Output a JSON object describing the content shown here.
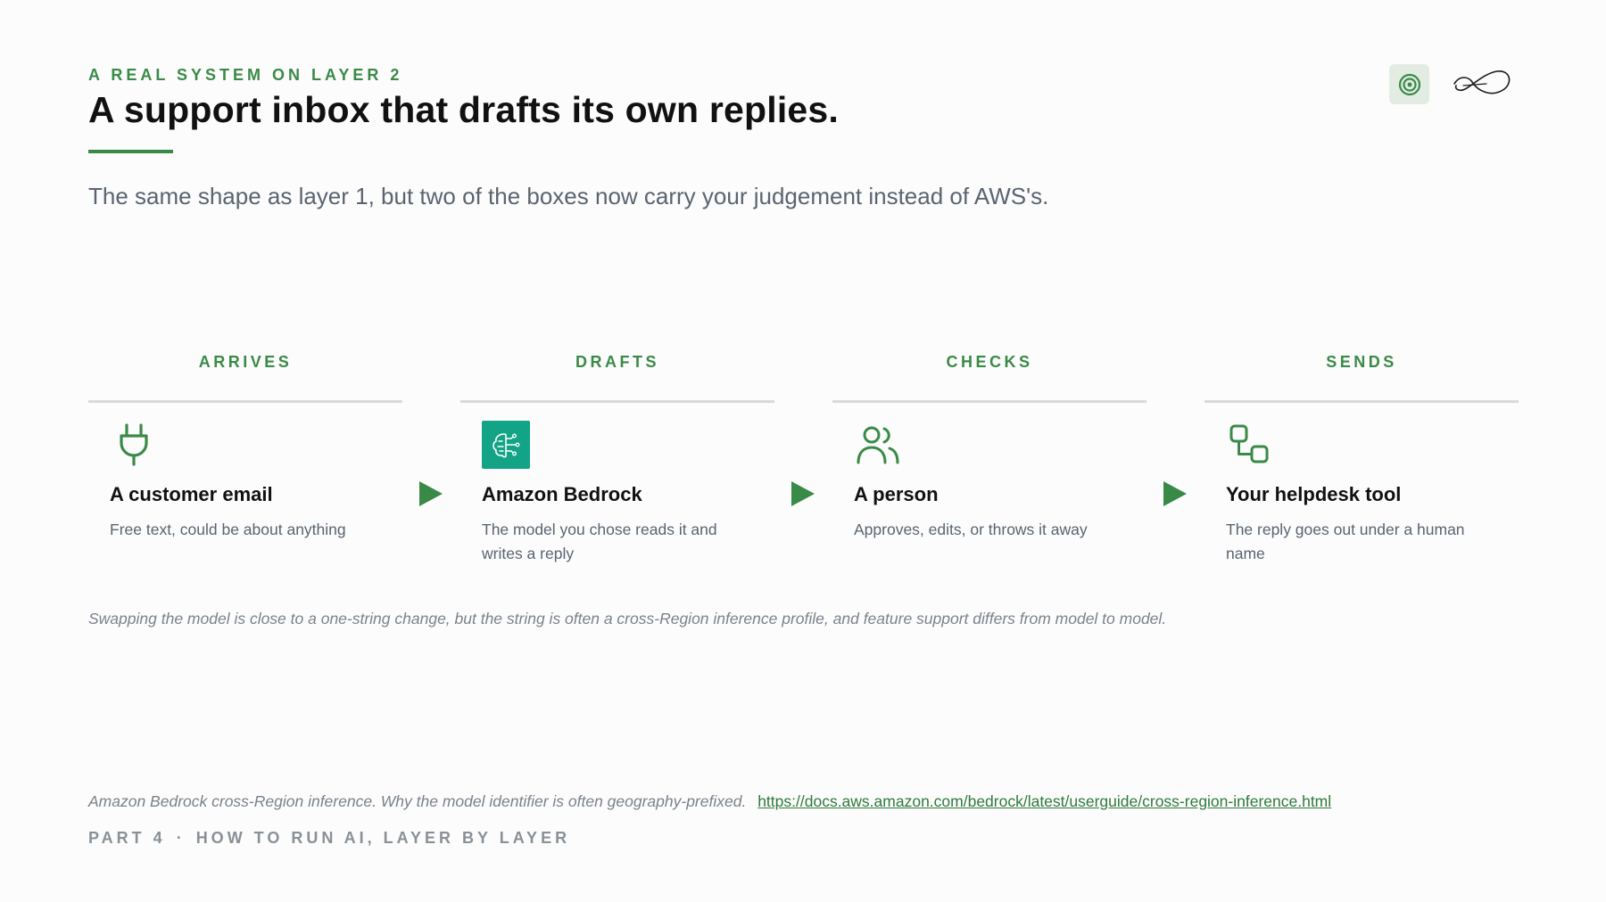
{
  "header": {
    "eyebrow": "A REAL SYSTEM ON LAYER 2",
    "title": "A support inbox that drafts its own replies.",
    "subtitle": "The same shape as layer 1, but two of the boxes now carry your judgement instead of AWS's."
  },
  "logos": {
    "target_icon": "target-icon",
    "signature_icon": "signature-icon"
  },
  "steps": [
    {
      "heading": "ARRIVES",
      "icon": "plug-icon",
      "title": "A customer email",
      "desc": "Free text, could be about anything"
    },
    {
      "heading": "DRAFTS",
      "icon": "bedrock-brain-icon",
      "title": "Amazon Bedrock",
      "desc": "The model you chose reads it and writes a reply"
    },
    {
      "heading": "CHECKS",
      "icon": "people-icon",
      "title": "A person",
      "desc": "Approves, edits, or throws it away"
    },
    {
      "heading": "SENDS",
      "icon": "workflow-icon",
      "title": "Your helpdesk tool",
      "desc": "The reply goes out under a human name"
    }
  ],
  "note": "Swapping the model is close to a one-string change, but the string is often a cross-Region inference profile, and feature support differs from model to model.",
  "source": {
    "text": "Amazon Bedrock cross-Region inference. Why the model identifier is often geography-prefixed.",
    "url": "https://docs.aws.amazon.com/bedrock/latest/userguide/cross-region-inference.html"
  },
  "footer": {
    "part": "PART 4",
    "separator": "·",
    "section": "HOW TO RUN AI, LAYER BY LAYER"
  },
  "colors": {
    "accent": "#3a8a47",
    "bedrock": "#13a386",
    "muted": "#5a6470"
  }
}
